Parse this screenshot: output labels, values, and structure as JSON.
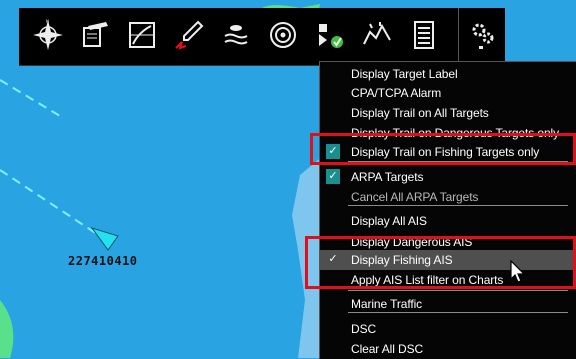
{
  "toolbar": {
    "buttons": [
      {
        "name": "compass-rose-icon",
        "label": "Compass"
      },
      {
        "name": "notebook-pen-icon",
        "label": "Notes"
      },
      {
        "name": "chart-grid-icon",
        "label": "Charts"
      },
      {
        "name": "route-pencil-icon",
        "label": "Routes"
      },
      {
        "name": "ais-wave-icon",
        "label": "AIS"
      },
      {
        "name": "target-radar-icon",
        "label": "Targets"
      },
      {
        "name": "layers-check-icon",
        "label": "Layers"
      },
      {
        "name": "tide-current-icon",
        "label": "Tides"
      },
      {
        "name": "data-list-icon",
        "label": "Data"
      },
      {
        "name": "settings-gears-icon",
        "label": "Settings"
      }
    ]
  },
  "chart": {
    "vessel_id": "227410410",
    "colors": {
      "sea": "#2aa3e3",
      "shallow": "#7ec6ee",
      "land": "#58e08a",
      "track": "#7ff0ff",
      "vessel": "#25e0f0"
    }
  },
  "menu": {
    "items": [
      {
        "label": "Display Target Label",
        "checked": false,
        "disabled": false
      },
      {
        "label": "CPA/TCPA Alarm",
        "checked": false,
        "disabled": false
      },
      {
        "label": "Display Trail on All Targets",
        "checked": false,
        "disabled": false
      },
      {
        "label": "Display Trail on Dangerous Targets only",
        "checked": false,
        "disabled": false
      },
      {
        "label": "Display Trail on Fishing Targets only",
        "checked": true,
        "disabled": false
      },
      {
        "label": "ARPA Targets",
        "checked": true,
        "disabled": false
      },
      {
        "label": "Cancel All ARPA Targets",
        "checked": false,
        "disabled": true
      },
      {
        "label": "Display All AIS",
        "checked": false,
        "disabled": false
      },
      {
        "label": "Display Dangerous AIS",
        "checked": false,
        "disabled": false
      },
      {
        "label": "Display Fishing AIS",
        "checked": true,
        "disabled": false,
        "highlighted": true
      },
      {
        "label": "Apply AIS List filter on Charts",
        "checked": false,
        "disabled": false
      },
      {
        "label": "Marine Traffic",
        "checked": false,
        "disabled": false
      },
      {
        "label": "DSC",
        "checked": false,
        "disabled": false
      },
      {
        "label": "Clear All DSC",
        "checked": false,
        "disabled": false
      }
    ],
    "check_glyph": "✓"
  }
}
